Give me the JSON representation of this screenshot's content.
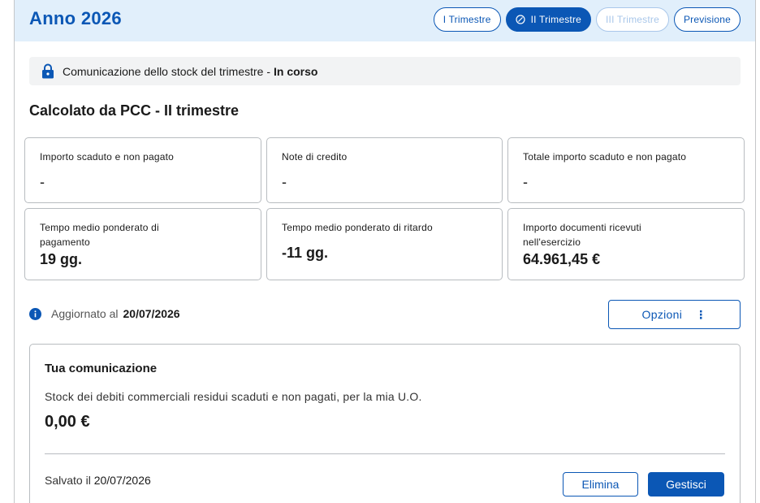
{
  "header": {
    "title": "Anno 2026",
    "tabs": [
      {
        "label": "I Trimestre",
        "state": "default"
      },
      {
        "label": "II Trimestre",
        "state": "active"
      },
      {
        "label": "III Trimestre",
        "state": "disabled"
      },
      {
        "label": "Previsione",
        "state": "default"
      }
    ]
  },
  "status": {
    "text": "Comunicazione dello stock del trimestre -",
    "state": "In corso"
  },
  "section": {
    "title": "Calcolato da PCC - II trimestre"
  },
  "cards": [
    {
      "label": "Importo scaduto e non pagato",
      "value": "-"
    },
    {
      "label": "Note di credito",
      "value": "-"
    },
    {
      "label": "Totale importo scaduto e non pagato",
      "value": "-"
    },
    {
      "label": "Tempo medio ponderato di pagamento",
      "value": "19 gg."
    },
    {
      "label": "Tempo medio ponderato di ritardo",
      "value": "-11 gg."
    },
    {
      "label": "Importo documenti ricevuti nell'esercizio",
      "value": "64.961,45 €"
    }
  ],
  "updated": {
    "label": "Aggiornato al",
    "date": "20/07/2026"
  },
  "options": {
    "label": "Opzioni",
    "menu_icon": "⋮"
  },
  "communication": {
    "title": "Tua comunicazione",
    "description": "Stock dei debiti commerciali residui scaduti e non pagati, per la mia U.O.",
    "amount": "0,00 €",
    "saved_label": "Salvato il",
    "saved_date": "20/07/2026",
    "delete_label": "Elimina",
    "manage_label": "Gestisci"
  },
  "colors": {
    "primary": "#0b57b5",
    "header_bg": "#e1effb",
    "disabled": "#a9c7ea"
  }
}
